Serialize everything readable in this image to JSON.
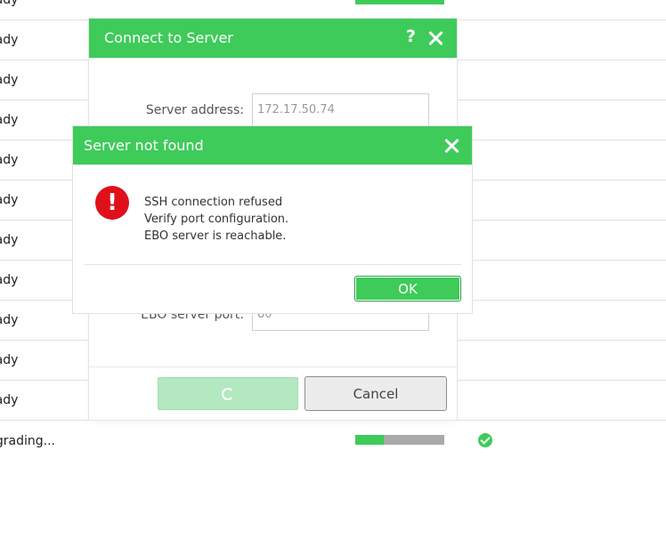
{
  "background": {
    "rows": [
      {
        "label": "eady"
      },
      {
        "label": "eady"
      },
      {
        "label": "eady"
      },
      {
        "label": "eady"
      },
      {
        "label": "eady"
      },
      {
        "label": "eady"
      },
      {
        "label": "eady"
      },
      {
        "label": "eady"
      },
      {
        "label": "eady"
      },
      {
        "label": "eady"
      },
      {
        "label": "eady"
      },
      {
        "label": "pgrading..."
      }
    ],
    "upgrade_progress": 0.32
  },
  "connect_dialog": {
    "title": "Connect to Server",
    "help_icon": "?",
    "server_address_label": "Server address:",
    "server_address_value": "172.17.50.74",
    "ebo_port_label": "EBO server port:",
    "ebo_port_value": "80",
    "cancel_label": "Cancel"
  },
  "error_dialog": {
    "title": "Server not found",
    "icon_glyph": "!",
    "messages": [
      "SSH connection refused",
      "Verify port configuration.",
      "EBO server is reachable."
    ],
    "ok_label": "OK"
  },
  "colors": {
    "accent": "#3ecb5a",
    "error": "#e0101b",
    "disabled_button": "#b3e8c0"
  },
  "icons": {
    "help": "help-icon",
    "close": "close-icon",
    "error": "error-icon",
    "spinner": "spinner-icon",
    "check": "check-circle-icon"
  }
}
